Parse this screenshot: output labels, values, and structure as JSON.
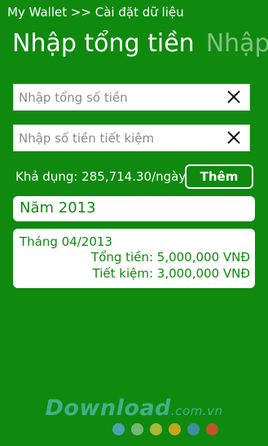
{
  "header": {
    "breadcrumb": "My Wallet >> Cài đặt dữ liệu"
  },
  "pivot": {
    "active_title": "Nhập tổng tiền",
    "next_title": "Nhập"
  },
  "inputs": {
    "total_placeholder": "Nhập tổng số tiền",
    "total_value": "",
    "savings_placeholder": "Nhập số tiền tiết kiệm",
    "savings_value": ""
  },
  "summary": {
    "available_text": "Khả dụng: 285,714.30/ngày",
    "add_button_label": "Thêm"
  },
  "entries": {
    "year_label": "Năm 2013",
    "month_title": "Tháng 04/2013",
    "total_line": "Tổng tiền: 5,000,000 VNĐ",
    "savings_line": "Tiết kiệm: 3,000,000 VNĐ"
  },
  "watermark": {
    "brand": "Download",
    "tld": ".com.vn"
  },
  "colors": {
    "background": "#0f8a0f",
    "accent": "#ffffff",
    "inactive_pivot": "#7fc27f",
    "dots": [
      "#4aa3b0",
      "#73b873",
      "#a9b83a",
      "#c9a31a",
      "#3d8fa0",
      "#c0532e"
    ]
  }
}
